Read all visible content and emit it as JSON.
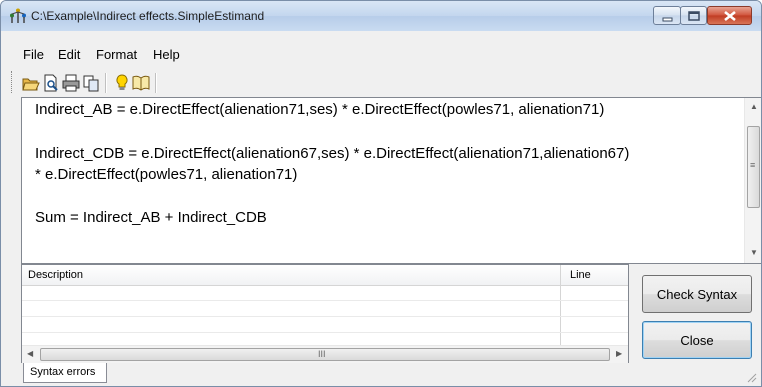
{
  "window": {
    "title": "C:\\Example\\Indirect effects.SimpleEstimand",
    "app_icon": "model-tree-icon",
    "controls": [
      "minimize-icon",
      "maximize-icon",
      "close-icon"
    ]
  },
  "menu": {
    "items": [
      {
        "label": "File"
      },
      {
        "label": "Edit"
      },
      {
        "label": "Format"
      },
      {
        "label": "Help"
      }
    ]
  },
  "toolbar": {
    "icons": [
      "open-folder-icon",
      "print-preview-icon",
      "print-icon",
      "copy-icon",
      "lightbulb-icon",
      "book-icon"
    ]
  },
  "editor": {
    "lines": [
      "Indirect_AB = e.DirectEffect(alienation71,ses) * e.DirectEffect(powles71, alienation71)",
      "",
      "Indirect_CDB = e.DirectEffect(alienation67,ses) * e.DirectEffect(alienation71,alienation67)",
      "* e.DirectEffect(powles71, alienation71)",
      "",
      "Sum = Indirect_AB + Indirect_CDB"
    ]
  },
  "errors_grid": {
    "columns": [
      "Description",
      "Line"
    ],
    "rows": []
  },
  "buttons": {
    "check_syntax": "Check Syntax",
    "close": "Close"
  },
  "tabs": {
    "syntax_errors": "Syntax errors"
  },
  "scrollbar": {
    "thumb_grip": "III"
  }
}
